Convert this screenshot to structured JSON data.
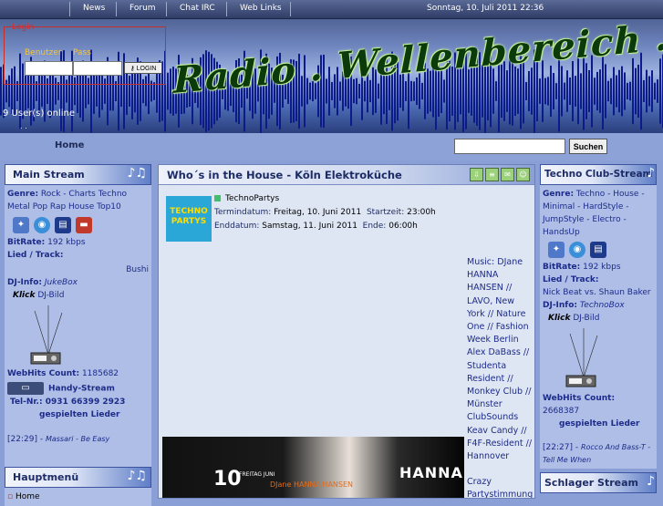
{
  "nav": {
    "items": [
      "News",
      "Forum",
      "Chat IRC",
      "Web Links"
    ],
    "datetime": "Sonntag, 10. Juli 2011  22:36"
  },
  "header": {
    "logo_text": "Radio . Wellenbereich . de",
    "users_online": "9 User(s) online",
    "dots": ". ."
  },
  "login": {
    "title": "Login",
    "user_label": "Benutzer",
    "pass_label": "Pass",
    "button": "LOGIN"
  },
  "bar": {
    "home": "Home",
    "search_button": "Suchen"
  },
  "left": {
    "main_stream": {
      "title": "Main Stream",
      "genre_label": "Genre:",
      "genre_value": "Rock - Charts Techno Metal Pop Rap House Top10",
      "bitrate_label": "BitRate:",
      "bitrate_value": "192  kbps",
      "song_label": "Lied / Track:",
      "song_value": "Bushi",
      "dj_label": "DJ-Info:",
      "dj_value": "JukeBox",
      "klick": "Klick",
      "dj_bild": "DJ-Bild",
      "hits_label": "WebHits Count:",
      "hits_value": "1185682",
      "handy": "Handy-Stream",
      "tel": "Tel-Nr.: 0931 66399 2923",
      "played": "gespielten Lieder",
      "last_time": "[22:29] -",
      "last_song": "Massari - Be Easy"
    },
    "hauptmenu": {
      "title": "Hauptmenü",
      "item1": "Home"
    }
  },
  "center": {
    "title": "Who´s in the House - Köln Elektroküche",
    "logo_text": "TECHNO PARTYS",
    "event_category": "TechnoPartys",
    "start_label": "Termindatum:",
    "start_date": "Freitag, 10. Juni 2011",
    "start_time_label": "Startzeit:",
    "start_time": "23:00h",
    "end_label": "Enddatum:",
    "end_date": "Samstag, 11. Juni 2011",
    "end_time_label": "Ende:",
    "end_time": "06:00h",
    "music_text": "Music: DJane HANNA HANSEN // LAVO, New York // Nature One // Fashion Week Berlin Alex DaBass // Studenta Resident // Monkey Club // Münster ClubSounds Keav Candy // F4F-Resident // Hannover",
    "music_text2": "Crazy Partystimmung",
    "flyer_num": "10",
    "flyer_day": "FREITAG JUNI",
    "flyer_dj": "DJane HANNA HANSEN",
    "flyer_name": "HANNA"
  },
  "right": {
    "techno": {
      "title": "Techno Club-Stream",
      "genre_label": "Genre:",
      "genre_value": "Techno - House - Minimal - HardStyle - JumpStyle - Electro - HandsUp",
      "bitrate_label": "BitRate:",
      "bitrate_value": "192  kbps",
      "song_label": "Lied / Track:",
      "song_value": "Nick Beat vs. Shaun Baker",
      "dj_label": "DJ-Info:",
      "dj_value": "TechnoBox",
      "klick": "Klick",
      "dj_bild": "DJ-Bild",
      "hits_label": "WebHits Count:",
      "hits_value": "2668387",
      "played": "gespielten Lieder",
      "last_time": "[22:27] -",
      "last_song": "Rocco And Bass-T - Tell Me When"
    },
    "schlager": {
      "title": "Schlager Stream"
    }
  },
  "colors": {
    "background": "#8a9fd6",
    "accent_text": "#1d2b8a",
    "login_red": "#d42d2d",
    "label_yellow": "#f5c53a"
  }
}
